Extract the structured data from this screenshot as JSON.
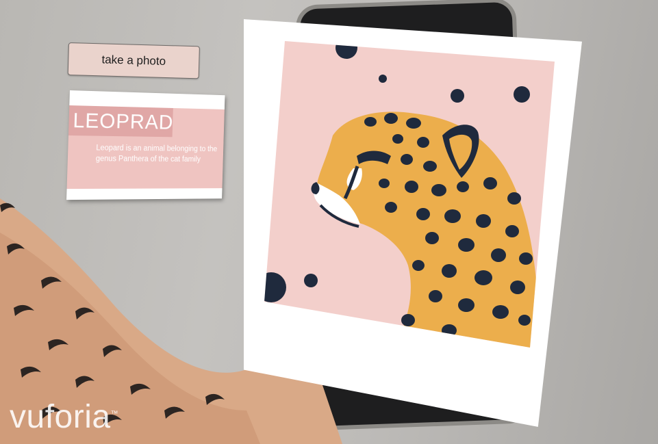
{
  "ar_ui": {
    "take_photo_label": "take a photo"
  },
  "info_card": {
    "title": "LEOPRAD",
    "description": "Leopard is an animal belonging to the genus Panthera of the cat family"
  },
  "polaroid": {
    "image_icon": "cheetah-illustration-icon"
  },
  "watermark": {
    "text": "vuforia",
    "trademark": "™"
  },
  "colors": {
    "card_pink": "#efc4c1",
    "title_pink": "#e0a7a6",
    "photo_background": "#f3cfcb",
    "cat_orange": "#ecae4c",
    "spot_navy": "#1f2a3d"
  }
}
